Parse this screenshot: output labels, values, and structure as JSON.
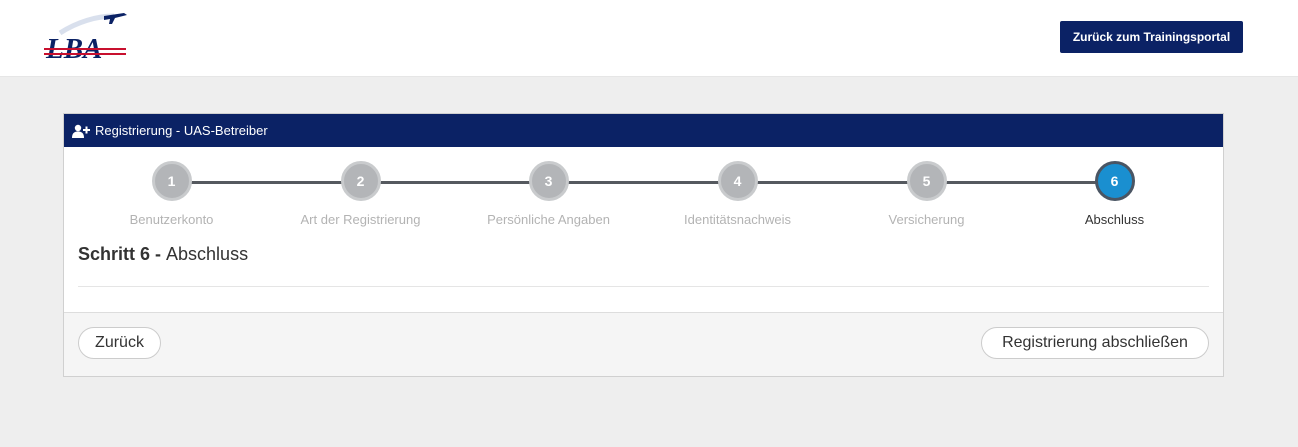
{
  "header": {
    "logo_text": "LBA",
    "back_button_label": "Zurück zum Trainingsportal"
  },
  "panel": {
    "title": "Registrierung - UAS-Betreiber",
    "icon": "user-plus-icon"
  },
  "steps": [
    {
      "number": "1",
      "label": "Benutzerkonto",
      "active": false
    },
    {
      "number": "2",
      "label": "Art der Registrierung",
      "active": false
    },
    {
      "number": "3",
      "label": "Persönliche Angaben",
      "active": false
    },
    {
      "number": "4",
      "label": "Identitätsnachweis",
      "active": false
    },
    {
      "number": "5",
      "label": "Versicherung",
      "active": false
    },
    {
      "number": "6",
      "label": "Abschluss",
      "active": true
    }
  ],
  "section": {
    "prefix": "Schritt 6",
    "separator": " - ",
    "name": "Abschluss"
  },
  "footer": {
    "back_label": "Zurück",
    "finish_label": "Registrierung abschließen"
  },
  "colors": {
    "brand_navy": "#0b2265",
    "step_inactive": "#b3b5b8",
    "step_active": "#1a8fd0"
  }
}
